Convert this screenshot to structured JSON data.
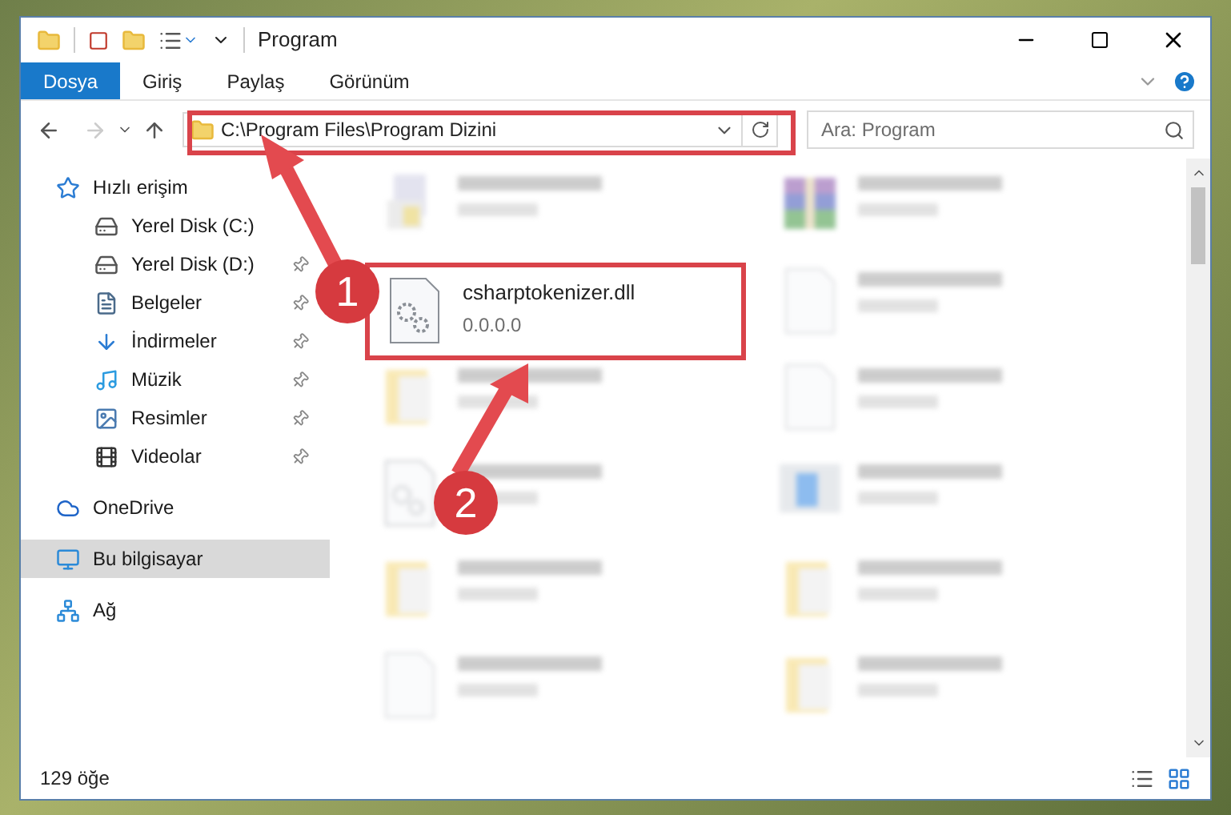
{
  "window": {
    "title": "Program"
  },
  "ribbon_tabs": [
    {
      "label": "Dosya",
      "selected": true
    },
    {
      "label": "Giriş",
      "selected": false
    },
    {
      "label": "Paylaş",
      "selected": false
    },
    {
      "label": "Görünüm",
      "selected": false
    }
  ],
  "address": {
    "path": "C:\\Program Files\\Program Dizini"
  },
  "search": {
    "placeholder": "Ara: Program"
  },
  "sidebar": {
    "items": [
      {
        "label": "Hızlı erişim",
        "kind": "quick",
        "selected": false,
        "pinned": false,
        "children": [
          {
            "label": "Yerel Disk (C:)",
            "kind": "diskc",
            "selected": false,
            "pinned": false
          },
          {
            "label": "Yerel Disk (D:)",
            "kind": "disk",
            "selected": false,
            "pinned": true
          },
          {
            "label": "Belgeler",
            "kind": "docs",
            "selected": false,
            "pinned": true
          },
          {
            "label": "İndirmeler",
            "kind": "downloads",
            "selected": false,
            "pinned": true
          },
          {
            "label": "Müzik",
            "kind": "music",
            "selected": false,
            "pinned": true
          },
          {
            "label": "Resimler",
            "kind": "pictures",
            "selected": false,
            "pinned": true
          },
          {
            "label": "Videolar",
            "kind": "videos",
            "selected": false,
            "pinned": true
          }
        ]
      },
      {
        "label": "OneDrive",
        "kind": "cloud",
        "selected": false,
        "pinned": false
      },
      {
        "label": "Bu bilgisayar",
        "kind": "pc",
        "selected": true,
        "pinned": false
      },
      {
        "label": "Ağ",
        "kind": "network",
        "selected": false,
        "pinned": false
      }
    ]
  },
  "files": [
    {
      "kind": "exe",
      "blurred": true
    },
    {
      "kind": "archive",
      "blurred": true
    },
    {
      "name": "csharptokenizer.dll",
      "detail": "0.0.0.0",
      "kind": "dll",
      "blurred": false,
      "highlighted": true
    },
    {
      "kind": "doc",
      "blurred": true
    },
    {
      "kind": "folder",
      "blurred": true
    },
    {
      "kind": "doc",
      "blurred": true
    },
    {
      "kind": "dll",
      "blurred": true
    },
    {
      "kind": "installer",
      "blurred": true
    },
    {
      "kind": "folder",
      "blurred": true
    },
    {
      "kind": "folder",
      "blurred": true
    },
    {
      "kind": "doc",
      "blurred": true
    },
    {
      "kind": "folder",
      "blurred": true
    }
  ],
  "status_bar": {
    "count": "129 öğe"
  },
  "annotations": [
    {
      "number": "1"
    },
    {
      "number": "2"
    }
  ]
}
